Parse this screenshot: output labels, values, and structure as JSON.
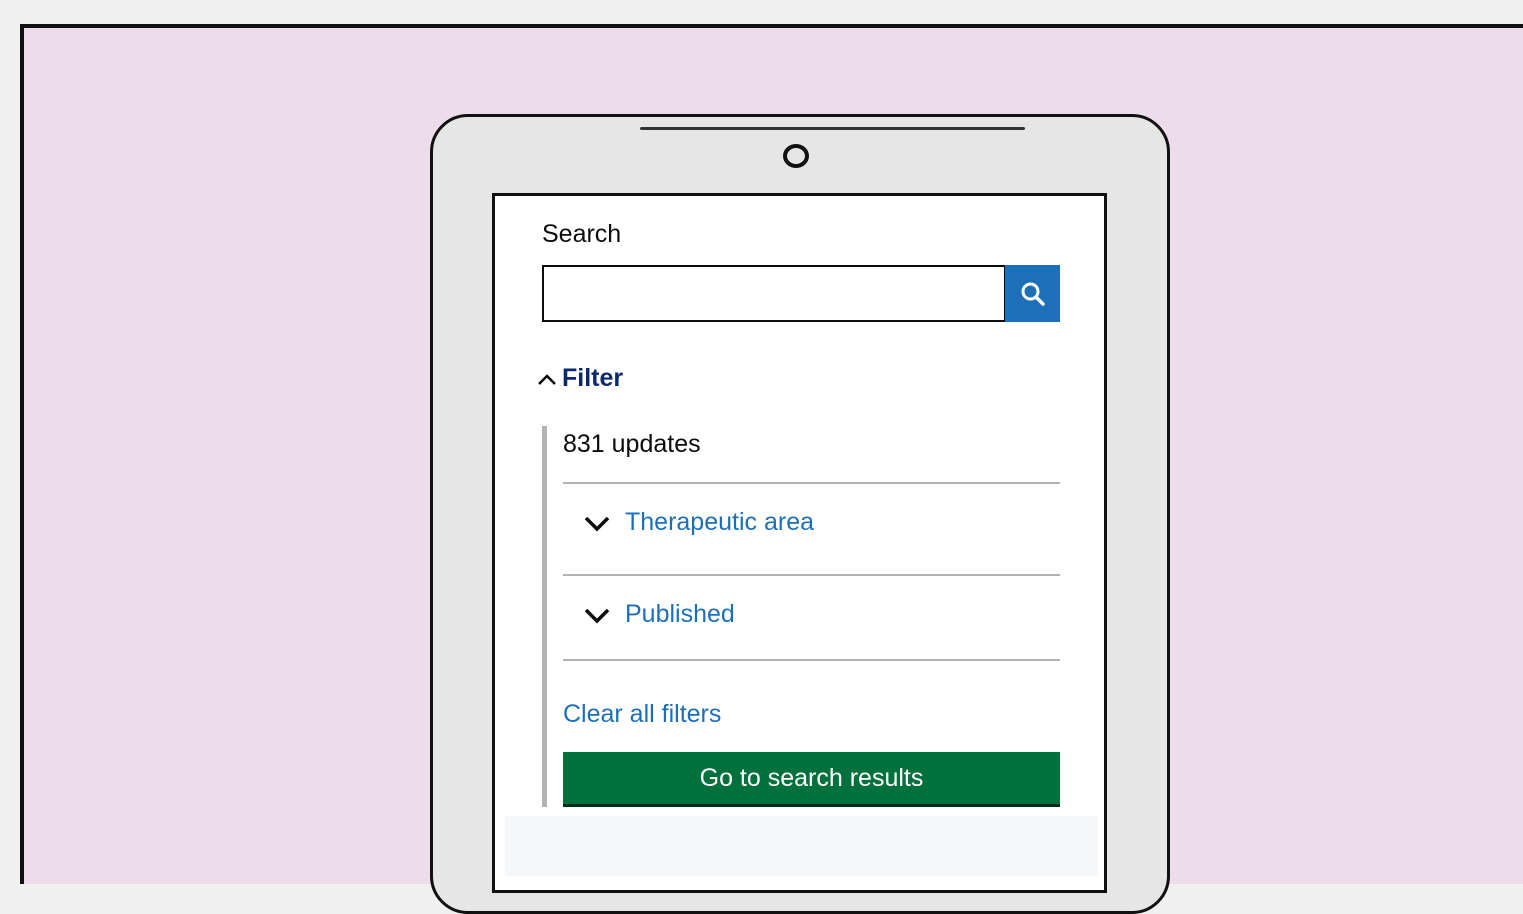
{
  "search": {
    "label": "Search",
    "value": "",
    "button_icon": "search-icon"
  },
  "filter": {
    "toggle_label": "Filter",
    "toggle_icon": "chevron-up-icon",
    "result_count": "831 updates",
    "sections": [
      {
        "label": "Therapeutic area",
        "icon": "chevron-down-icon"
      },
      {
        "label": "Published",
        "icon": "chevron-down-icon"
      }
    ],
    "clear_label": "Clear all filters",
    "submit_label": "Go to search results"
  },
  "colors": {
    "background": "#eddcec",
    "link": "#1d70b8",
    "primary_button": "#00703c",
    "search_button": "#1d70b8"
  }
}
